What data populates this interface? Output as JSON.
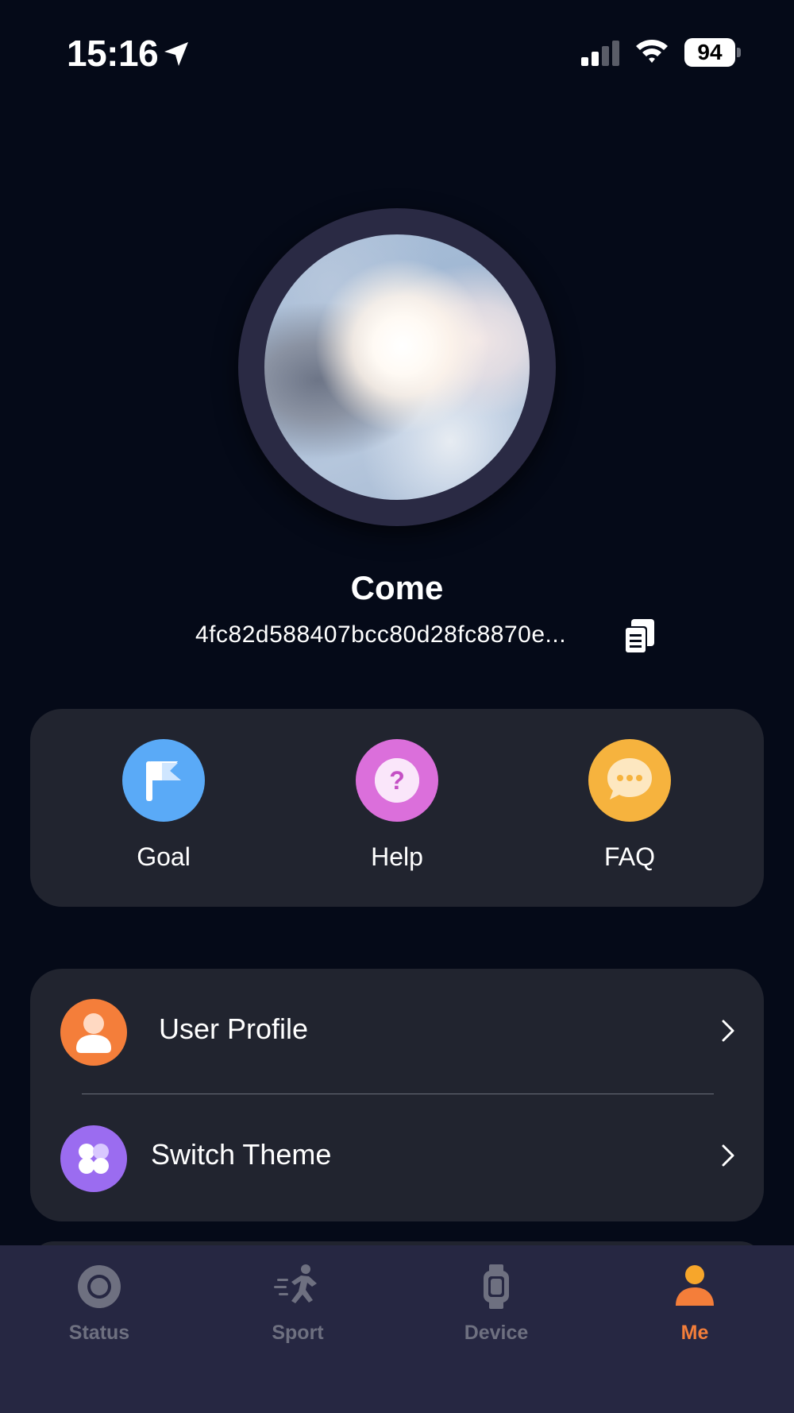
{
  "status_bar": {
    "time": "15:16",
    "battery": "94",
    "icons": [
      "location-arrow-icon",
      "cellular-signal-icon",
      "wifi-icon",
      "battery-icon"
    ]
  },
  "profile": {
    "name": "Come",
    "id": "4fc82d588407bcc80d28fc8870e...",
    "avatar": "sky-clouds-photo",
    "copy_icon": "copy-icon"
  },
  "quick_actions": [
    {
      "label": "Goal",
      "icon": "flag-icon",
      "color": "#5aaaf7"
    },
    {
      "label": "Help",
      "icon": "question-icon",
      "color": "#db6fdb"
    },
    {
      "label": "FAQ",
      "icon": "chat-bubble-icon",
      "color": "#f6b33e"
    }
  ],
  "settings": [
    {
      "label": "User Profile",
      "icon": "user-icon",
      "color": "#f47e3a"
    },
    {
      "label": "Switch Theme",
      "icon": "theme-grid-icon",
      "color": "#9b6cf0"
    }
  ],
  "tabs": [
    {
      "label": "Status",
      "icon": "status-ring-icon",
      "active": false
    },
    {
      "label": "Sport",
      "icon": "running-person-icon",
      "active": false
    },
    {
      "label": "Device",
      "icon": "watch-icon",
      "active": false
    },
    {
      "label": "Me",
      "icon": "person-icon",
      "active": true
    }
  ],
  "colors": {
    "background": "#050a18",
    "card": "#21242f",
    "tab_bar": "#262742",
    "accent": "#f47e3a",
    "inactive": "#6e7080"
  }
}
